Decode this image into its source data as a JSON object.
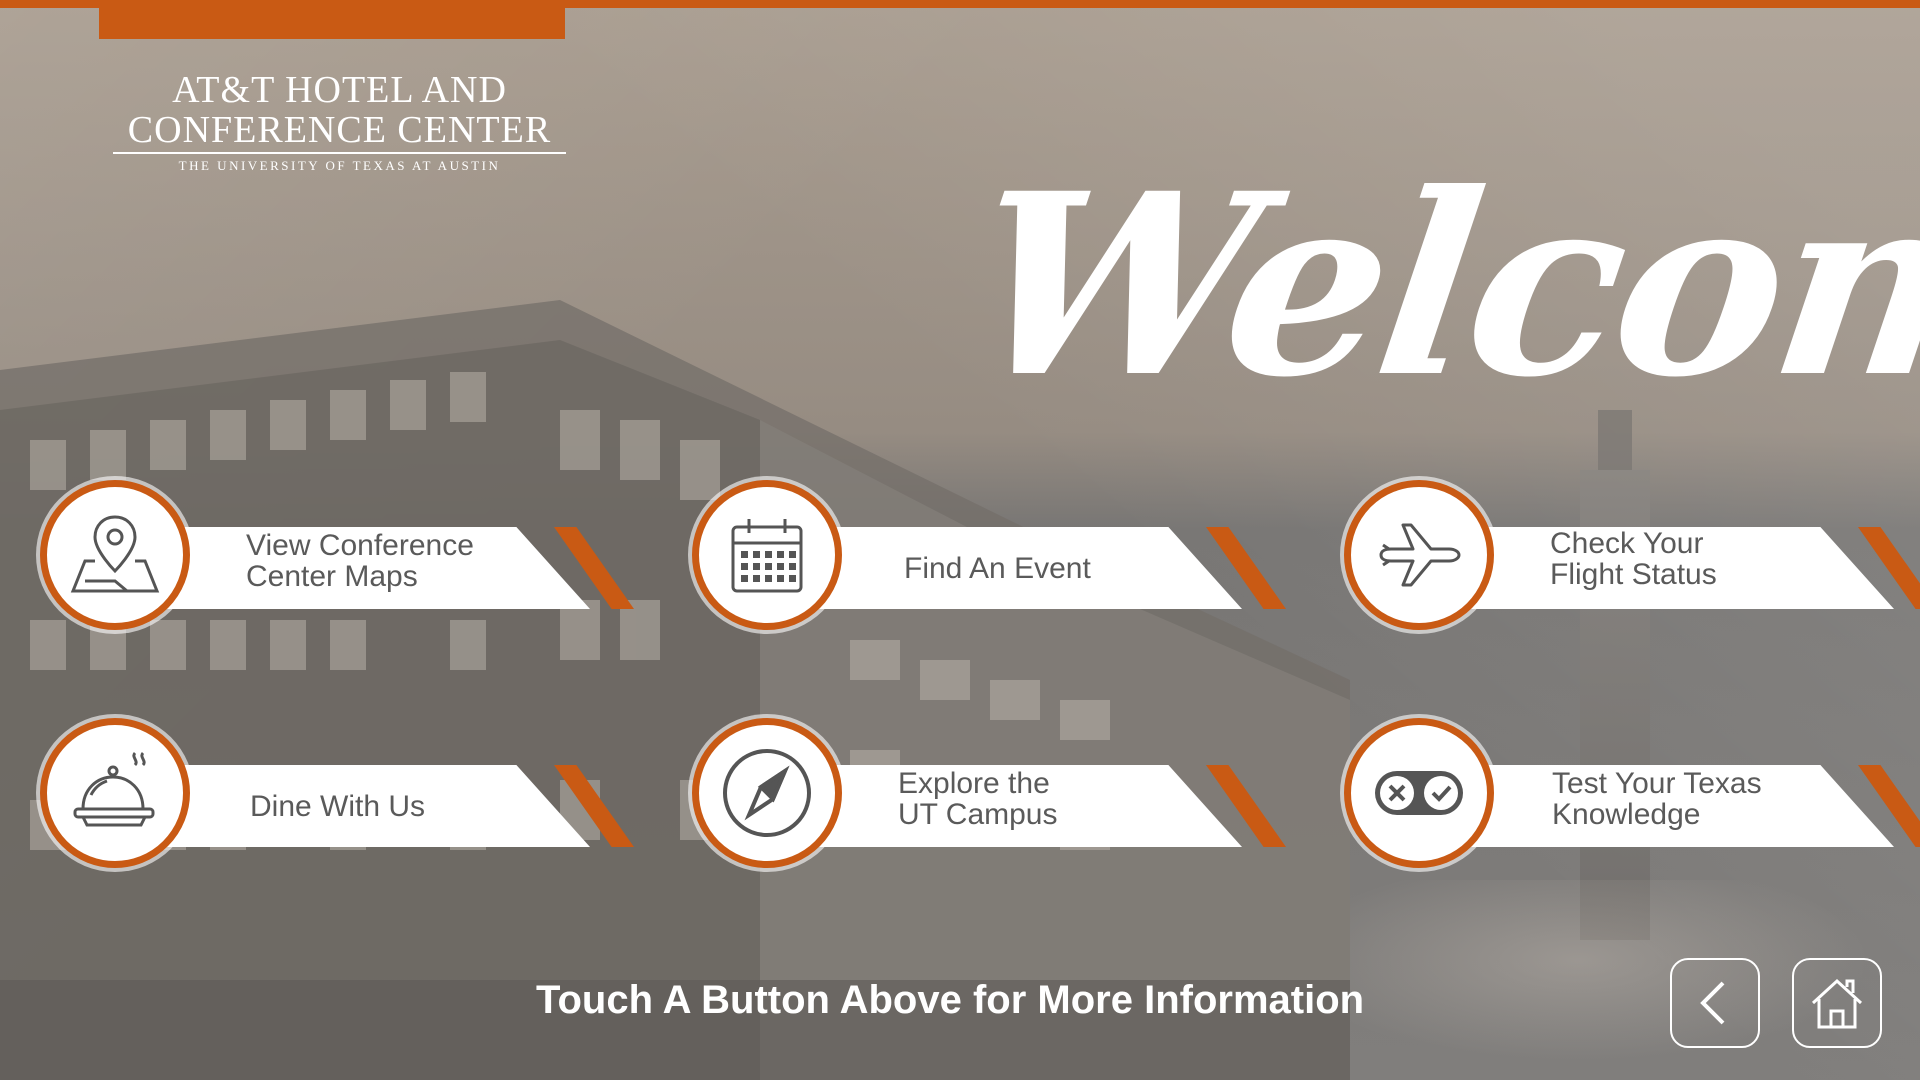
{
  "header": {
    "logo_line1": "AT&T HOTEL AND",
    "logo_line2": "CONFERENCE CENTER",
    "logo_line3": "THE UNIVERSITY OF TEXAS AT AUSTIN",
    "welcome": "Welcome"
  },
  "buttons": [
    {
      "line1": "View Conference",
      "line2": "Center Maps",
      "icon": "map-pin-icon"
    },
    {
      "line1": "Find An Event",
      "line2": "",
      "icon": "calendar-icon"
    },
    {
      "line1": "Check Your",
      "line2": "Flight Status",
      "icon": "airplane-icon"
    },
    {
      "line1": "Dine With Us",
      "line2": "",
      "icon": "food-cloche-icon"
    },
    {
      "line1": "Explore the",
      "line2": "UT Campus",
      "icon": "compass-icon"
    },
    {
      "line1": "Test Your Texas",
      "line2": "Knowledge",
      "icon": "quiz-icon"
    }
  ],
  "footer": {
    "instruction": "Touch A Button Above for More Information",
    "back_icon": "chevron-left-icon",
    "home_icon": "home-icon"
  },
  "colors": {
    "accent": "#c95a14",
    "text": "#5a5a5a",
    "white": "#ffffff"
  }
}
